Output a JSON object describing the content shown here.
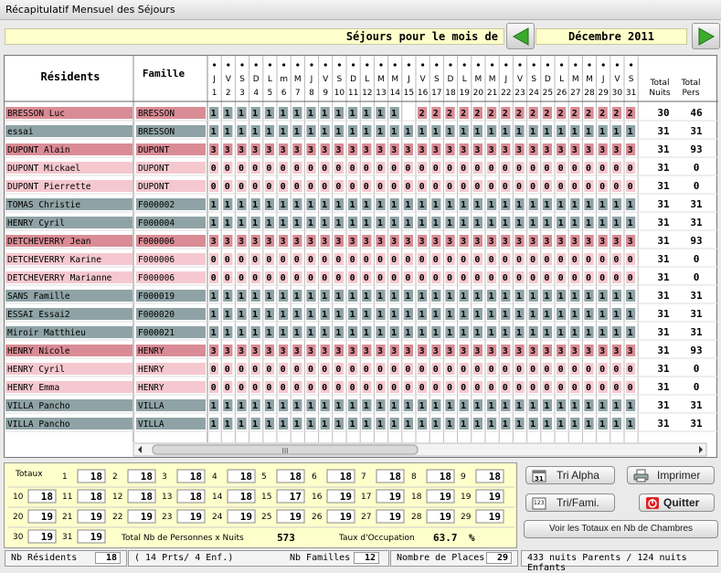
{
  "window": {
    "title": "Récapitulatif Mensuel des Séjours"
  },
  "header": {
    "banner": "Séjours pour le mois de",
    "month": "Décembre 2011"
  },
  "columns": {
    "residents": "Résidents",
    "famille": "Famille",
    "total_nuits": [
      "Total",
      "Nuits"
    ],
    "total_pers": [
      "Total",
      "Pers"
    ]
  },
  "days": [
    {
      "d": "J",
      "n": "1"
    },
    {
      "d": "V",
      "n": "2"
    },
    {
      "d": "S",
      "n": "3"
    },
    {
      "d": "D",
      "n": "4"
    },
    {
      "d": "L",
      "n": "5"
    },
    {
      "d": "m",
      "n": "6"
    },
    {
      "d": "M",
      "n": "7"
    },
    {
      "d": "J",
      "n": "8"
    },
    {
      "d": "V",
      "n": "9"
    },
    {
      "d": "S",
      "n": "10"
    },
    {
      "d": "D",
      "n": "11"
    },
    {
      "d": "L",
      "n": "12"
    },
    {
      "d": "M",
      "n": "13"
    },
    {
      "d": "M",
      "n": "14"
    },
    {
      "d": "J",
      "n": "15"
    },
    {
      "d": "V",
      "n": "16"
    },
    {
      "d": "S",
      "n": "17"
    },
    {
      "d": "D",
      "n": "18"
    },
    {
      "d": "L",
      "n": "19"
    },
    {
      "d": "M",
      "n": "20"
    },
    {
      "d": "M",
      "n": "21"
    },
    {
      "d": "J",
      "n": "22"
    },
    {
      "d": "V",
      "n": "23"
    },
    {
      "d": "S",
      "n": "24"
    },
    {
      "d": "D",
      "n": "25"
    },
    {
      "d": "L",
      "n": "26"
    },
    {
      "d": "M",
      "n": "27"
    },
    {
      "d": "M",
      "n": "28"
    },
    {
      "d": "J",
      "n": "29"
    },
    {
      "d": "V",
      "n": "30"
    },
    {
      "d": "S",
      "n": "31"
    }
  ],
  "rows": [
    {
      "name": "BRESSON Luc",
      "famille": "BRESSON",
      "color": "#d98c95",
      "values": [
        "1",
        "1",
        "1",
        "1",
        "1",
        "1",
        "1",
        "1",
        "1",
        "1",
        "1",
        "1",
        "1",
        "1",
        "",
        "2",
        "2",
        "2",
        "2",
        "2",
        "2",
        "2",
        "2",
        "2",
        "2",
        "2",
        "2",
        "2",
        "2",
        "2",
        "2"
      ],
      "nuits": "30",
      "pers": "46"
    },
    {
      "name": "essai",
      "famille": "BRESSON",
      "color": "#8fa3a6",
      "values": [
        "1",
        "1",
        "1",
        "1",
        "1",
        "1",
        "1",
        "1",
        "1",
        "1",
        "1",
        "1",
        "1",
        "1",
        "1",
        "1",
        "1",
        "1",
        "1",
        "1",
        "1",
        "1",
        "1",
        "1",
        "1",
        "1",
        "1",
        "1",
        "1",
        "1",
        "1"
      ],
      "nuits": "31",
      "pers": "31"
    },
    {
      "name": "DUPONT Alain",
      "famille": "DUPONT",
      "color": "#d98c95",
      "values": [
        "3",
        "3",
        "3",
        "3",
        "3",
        "3",
        "3",
        "3",
        "3",
        "3",
        "3",
        "3",
        "3",
        "3",
        "3",
        "3",
        "3",
        "3",
        "3",
        "3",
        "3",
        "3",
        "3",
        "3",
        "3",
        "3",
        "3",
        "3",
        "3",
        "3",
        "3"
      ],
      "nuits": "31",
      "pers": "93"
    },
    {
      "name": "DUPONT Mickael",
      "famille": "DUPONT",
      "color": "#f5c8cf",
      "values": [
        "0",
        "0",
        "0",
        "0",
        "0",
        "0",
        "0",
        "0",
        "0",
        "0",
        "0",
        "0",
        "0",
        "0",
        "0",
        "0",
        "0",
        "0",
        "0",
        "0",
        "0",
        "0",
        "0",
        "0",
        "0",
        "0",
        "0",
        "0",
        "0",
        "0",
        "0"
      ],
      "nuits": "31",
      "pers": "0"
    },
    {
      "name": "DUPONT Pierrette",
      "famille": "DUPONT",
      "color": "#f5c8cf",
      "values": [
        "0",
        "0",
        "0",
        "0",
        "0",
        "0",
        "0",
        "0",
        "0",
        "0",
        "0",
        "0",
        "0",
        "0",
        "0",
        "0",
        "0",
        "0",
        "0",
        "0",
        "0",
        "0",
        "0",
        "0",
        "0",
        "0",
        "0",
        "0",
        "0",
        "0",
        "0"
      ],
      "nuits": "31",
      "pers": "0"
    },
    {
      "name": "TOMAS Christie",
      "famille": "F000002",
      "color": "#8fa3a6",
      "values": [
        "1",
        "1",
        "1",
        "1",
        "1",
        "1",
        "1",
        "1",
        "1",
        "1",
        "1",
        "1",
        "1",
        "1",
        "1",
        "1",
        "1",
        "1",
        "1",
        "1",
        "1",
        "1",
        "1",
        "1",
        "1",
        "1",
        "1",
        "1",
        "1",
        "1",
        "1"
      ],
      "nuits": "31",
      "pers": "31"
    },
    {
      "name": "HENRY Cyril",
      "famille": "F000004",
      "color": "#8fa3a6",
      "values": [
        "1",
        "1",
        "1",
        "1",
        "1",
        "1",
        "1",
        "1",
        "1",
        "1",
        "1",
        "1",
        "1",
        "1",
        "1",
        "1",
        "1",
        "1",
        "1",
        "1",
        "1",
        "1",
        "1",
        "1",
        "1",
        "1",
        "1",
        "1",
        "1",
        "1",
        "1"
      ],
      "nuits": "31",
      "pers": "31"
    },
    {
      "name": "DETCHEVERRY Jean",
      "famille": "F000006",
      "color": "#d98c95",
      "values": [
        "3",
        "3",
        "3",
        "3",
        "3",
        "3",
        "3",
        "3",
        "3",
        "3",
        "3",
        "3",
        "3",
        "3",
        "3",
        "3",
        "3",
        "3",
        "3",
        "3",
        "3",
        "3",
        "3",
        "3",
        "3",
        "3",
        "3",
        "3",
        "3",
        "3",
        "3"
      ],
      "nuits": "31",
      "pers": "93"
    },
    {
      "name": "DETCHEVERRY Karine",
      "famille": "F000006",
      "color": "#f5c8cf",
      "values": [
        "0",
        "0",
        "0",
        "0",
        "0",
        "0",
        "0",
        "0",
        "0",
        "0",
        "0",
        "0",
        "0",
        "0",
        "0",
        "0",
        "0",
        "0",
        "0",
        "0",
        "0",
        "0",
        "0",
        "0",
        "0",
        "0",
        "0",
        "0",
        "0",
        "0",
        "0"
      ],
      "nuits": "31",
      "pers": "0"
    },
    {
      "name": "DETCHEVERRY Marianne",
      "famille": "F000006",
      "color": "#f5c8cf",
      "values": [
        "0",
        "0",
        "0",
        "0",
        "0",
        "0",
        "0",
        "0",
        "0",
        "0",
        "0",
        "0",
        "0",
        "0",
        "0",
        "0",
        "0",
        "0",
        "0",
        "0",
        "0",
        "0",
        "0",
        "0",
        "0",
        "0",
        "0",
        "0",
        "0",
        "0",
        "0"
      ],
      "nuits": "31",
      "pers": "0"
    },
    {
      "name": "SANS Famille",
      "famille": "F000019",
      "color": "#8fa3a6",
      "values": [
        "1",
        "1",
        "1",
        "1",
        "1",
        "1",
        "1",
        "1",
        "1",
        "1",
        "1",
        "1",
        "1",
        "1",
        "1",
        "1",
        "1",
        "1",
        "1",
        "1",
        "1",
        "1",
        "1",
        "1",
        "1",
        "1",
        "1",
        "1",
        "1",
        "1",
        "1"
      ],
      "nuits": "31",
      "pers": "31"
    },
    {
      "name": "ESSAI Essai2",
      "famille": "F000020",
      "color": "#8fa3a6",
      "values": [
        "1",
        "1",
        "1",
        "1",
        "1",
        "1",
        "1",
        "1",
        "1",
        "1",
        "1",
        "1",
        "1",
        "1",
        "1",
        "1",
        "1",
        "1",
        "1",
        "1",
        "1",
        "1",
        "1",
        "1",
        "1",
        "1",
        "1",
        "1",
        "1",
        "1",
        "1"
      ],
      "nuits": "31",
      "pers": "31"
    },
    {
      "name": "Miroir Matthieu",
      "famille": "F000021",
      "color": "#8fa3a6",
      "values": [
        "1",
        "1",
        "1",
        "1",
        "1",
        "1",
        "1",
        "1",
        "1",
        "1",
        "1",
        "1",
        "1",
        "1",
        "1",
        "1",
        "1",
        "1",
        "1",
        "1",
        "1",
        "1",
        "1",
        "1",
        "1",
        "1",
        "1",
        "1",
        "1",
        "1",
        "1"
      ],
      "nuits": "31",
      "pers": "31"
    },
    {
      "name": "HENRY Nicole",
      "famille": "HENRY",
      "color": "#d98c95",
      "values": [
        "3",
        "3",
        "3",
        "3",
        "3",
        "3",
        "3",
        "3",
        "3",
        "3",
        "3",
        "3",
        "3",
        "3",
        "3",
        "3",
        "3",
        "3",
        "3",
        "3",
        "3",
        "3",
        "3",
        "3",
        "3",
        "3",
        "3",
        "3",
        "3",
        "3",
        "3"
      ],
      "nuits": "31",
      "pers": "93"
    },
    {
      "name": "HENRY Cyril",
      "famille": "HENRY",
      "color": "#f5c8cf",
      "values": [
        "0",
        "0",
        "0",
        "0",
        "0",
        "0",
        "0",
        "0",
        "0",
        "0",
        "0",
        "0",
        "0",
        "0",
        "0",
        "0",
        "0",
        "0",
        "0",
        "0",
        "0",
        "0",
        "0",
        "0",
        "0",
        "0",
        "0",
        "0",
        "0",
        "0",
        "0"
      ],
      "nuits": "31",
      "pers": "0"
    },
    {
      "name": "HENRY Emma",
      "famille": "HENRY",
      "color": "#f5c8cf",
      "values": [
        "0",
        "0",
        "0",
        "0",
        "0",
        "0",
        "0",
        "0",
        "0",
        "0",
        "0",
        "0",
        "0",
        "0",
        "0",
        "0",
        "0",
        "0",
        "0",
        "0",
        "0",
        "0",
        "0",
        "0",
        "0",
        "0",
        "0",
        "0",
        "0",
        "0",
        "0"
      ],
      "nuits": "31",
      "pers": "0"
    },
    {
      "name": "VILLA Pancho",
      "famille": "VILLA",
      "color": "#8fa3a6",
      "values": [
        "1",
        "1",
        "1",
        "1",
        "1",
        "1",
        "1",
        "1",
        "1",
        "1",
        "1",
        "1",
        "1",
        "1",
        "1",
        "1",
        "1",
        "1",
        "1",
        "1",
        "1",
        "1",
        "1",
        "1",
        "1",
        "1",
        "1",
        "1",
        "1",
        "1",
        "1"
      ],
      "nuits": "31",
      "pers": "31"
    },
    {
      "name": "VILLA Pancho",
      "famille": "VILLA",
      "color": "#8fa3a6",
      "values": [
        "1",
        "1",
        "1",
        "1",
        "1",
        "1",
        "1",
        "1",
        "1",
        "1",
        "1",
        "1",
        "1",
        "1",
        "1",
        "1",
        "1",
        "1",
        "1",
        "1",
        "1",
        "1",
        "1",
        "1",
        "1",
        "1",
        "1",
        "1",
        "1",
        "1",
        "1"
      ],
      "nuits": "31",
      "pers": "31"
    }
  ],
  "colors": {
    "one": "#8fa3a6",
    "two": "#d98c95",
    "three": "#d98c95",
    "zero": "#f5c8cf",
    "panel": "#ffffcc",
    "nav_green": "#3caa2e"
  },
  "totaux": {
    "label": "Totaux",
    "cells": [
      {
        "n": "1",
        "v": "18"
      },
      {
        "n": "2",
        "v": "18"
      },
      {
        "n": "3",
        "v": "18"
      },
      {
        "n": "4",
        "v": "18"
      },
      {
        "n": "5",
        "v": "18"
      },
      {
        "n": "6",
        "v": "18"
      },
      {
        "n": "7",
        "v": "18"
      },
      {
        "n": "8",
        "v": "18"
      },
      {
        "n": "9",
        "v": "18"
      },
      {
        "n": "10",
        "v": "18"
      },
      {
        "n": "11",
        "v": "18"
      },
      {
        "n": "12",
        "v": "18"
      },
      {
        "n": "13",
        "v": "18"
      },
      {
        "n": "14",
        "v": "18"
      },
      {
        "n": "15",
        "v": "17"
      },
      {
        "n": "16",
        "v": "19"
      },
      {
        "n": "17",
        "v": "19"
      },
      {
        "n": "18",
        "v": "19"
      },
      {
        "n": "19",
        "v": "19"
      },
      {
        "n": "20",
        "v": "19"
      },
      {
        "n": "21",
        "v": "19"
      },
      {
        "n": "22",
        "v": "19"
      },
      {
        "n": "23",
        "v": "19"
      },
      {
        "n": "24",
        "v": "19"
      },
      {
        "n": "25",
        "v": "19"
      },
      {
        "n": "26",
        "v": "19"
      },
      {
        "n": "27",
        "v": "19"
      },
      {
        "n": "28",
        "v": "19"
      },
      {
        "n": "29",
        "v": "19"
      },
      {
        "n": "30",
        "v": "19"
      },
      {
        "n": "31",
        "v": "19"
      }
    ],
    "total_label": "Total Nb de Personnes x Nuits",
    "total_value": "573",
    "taux_label": "Taux d'Occupation",
    "taux_value": "63.7",
    "taux_unit": "%"
  },
  "buttons": {
    "tri_alpha": "Tri Alpha",
    "imprimer": "Imprimer",
    "tri_fami": "Tri/Fami.",
    "quitter": "Quitter",
    "voir_totaux": "Voir les Totaux en Nb de Chambres"
  },
  "status": {
    "nb_residents_label": "Nb Résidents",
    "nb_residents": "18",
    "detail": "( 14 Prts/  4 Enf.)",
    "nb_familles_label": "Nb Familles",
    "nb_familles": "12",
    "places_label": "Nombre de Places :",
    "places": "29",
    "nuits_summary": "433 nuits Parents  / 124 nuits Enfants"
  },
  "scroll": {
    "thumb_glyph": "III"
  }
}
